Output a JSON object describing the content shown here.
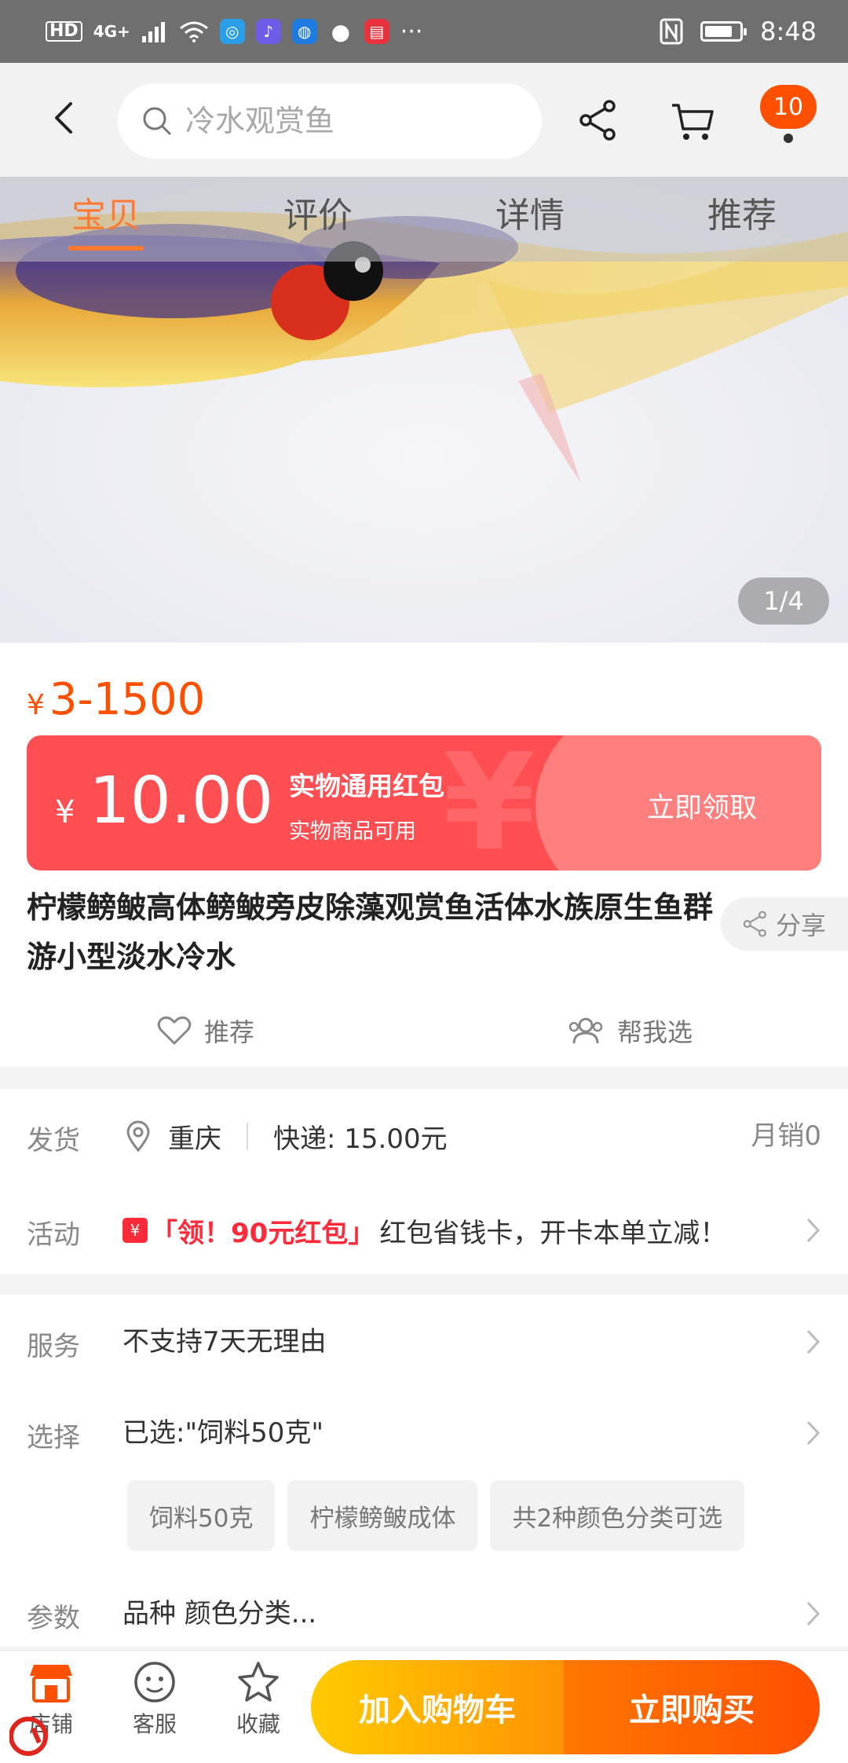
{
  "status_bar": {
    "hd": "HD",
    "signal": "4G+",
    "more": "···",
    "time": "8:48",
    "battery_level": 0.8
  },
  "header": {
    "search_placeholder": "冷水观赏鱼",
    "cart_badge": "10"
  },
  "tabs": [
    {
      "label": "宝贝",
      "active": true
    },
    {
      "label": "评价",
      "active": false
    },
    {
      "label": "详情",
      "active": false
    },
    {
      "label": "推荐",
      "active": false
    }
  ],
  "gallery": {
    "counter": "1/4"
  },
  "product": {
    "price_symbol": "¥",
    "price": "3-1500",
    "title": "柠檬鳑鲏高体鳑鲏旁皮除藻观赏鱼活体水族原生鱼群游小型淡水冷水",
    "share_label": "分享",
    "recommend_label": "推荐",
    "help_choose_label": "帮我选"
  },
  "coupon": {
    "symbol": "¥",
    "amount": "10.00",
    "title": "实物通用红包",
    "subtitle": "实物商品可用",
    "claim_label": "立即领取"
  },
  "shipping": {
    "label": "发货",
    "location": "重庆",
    "express": "快递: 15.00元",
    "monthly_sales": "月销0"
  },
  "activity": {
    "label": "活动",
    "highlight": "「领！90元红包」",
    "text": "红包省钱卡，开卡本单立减！"
  },
  "service": {
    "label": "服务",
    "value": "不支持7天无理由"
  },
  "selection": {
    "label": "选择",
    "value": "已选:\"饲料50克\"",
    "chips": [
      "饲料50克",
      "柠檬鳑鲏成体",
      "共2种颜色分类可选"
    ]
  },
  "params": {
    "label": "参数",
    "value": "品种 颜色分类..."
  },
  "bottom_bar": {
    "store_label": "店铺",
    "service_label": "客服",
    "favorite_label": "收藏",
    "add_cart_label": "加入购物车",
    "buy_now_label": "立即购买"
  },
  "colors": {
    "accent": "#ff5000",
    "coupon_red": "#ff4f52",
    "tab_active": "#ff7a30",
    "cart_gradient_start": "#ffcb00",
    "buy_gradient_end": "#ff4f00"
  }
}
